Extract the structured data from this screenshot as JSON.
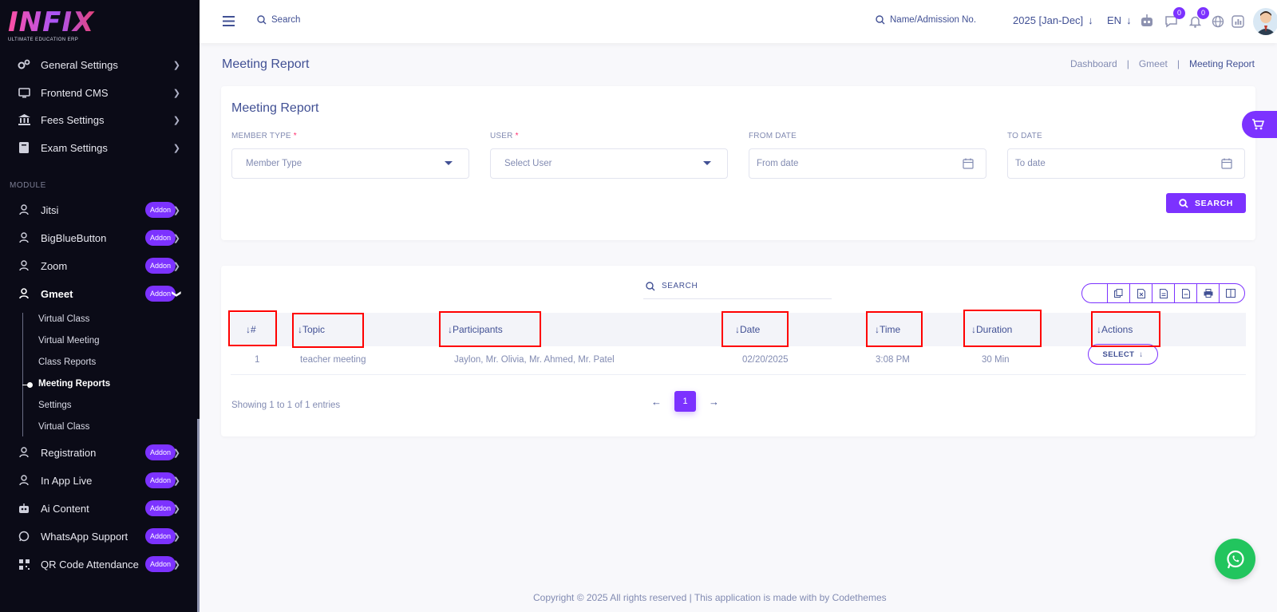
{
  "brand": {
    "name": "INFIX",
    "tagline": "ULTIMATE EDUCATION ERP",
    "accent": "#7c32ff"
  },
  "sidebar": {
    "items": [
      {
        "label": "General Settings",
        "icon": "gears-icon"
      },
      {
        "label": "Frontend CMS",
        "icon": "monitor-icon"
      },
      {
        "label": "Fees Settings",
        "icon": "bank-icon"
      },
      {
        "label": "Exam Settings",
        "icon": "book-icon"
      }
    ],
    "module_heading": "MODULE",
    "modules": [
      {
        "label": "Jitsi",
        "badge": "Addon"
      },
      {
        "label": "BigBlueButton",
        "badge": "Addon"
      },
      {
        "label": "Zoom",
        "badge": "Addon"
      },
      {
        "label": "Gmeet",
        "badge": "Addon"
      }
    ],
    "gmeet_sub": [
      "Virtual Class",
      "Virtual Meeting",
      "Class Reports",
      "Meeting Reports",
      "Settings",
      "Virtual Class"
    ],
    "more_modules": [
      {
        "label": "Registration",
        "badge": "Addon"
      },
      {
        "label": "In App Live",
        "badge": "Addon"
      },
      {
        "label": "Ai Content",
        "badge": "Addon"
      },
      {
        "label": "WhatsApp Support",
        "badge": "Addon"
      },
      {
        "label": "QR Code Attendance",
        "badge": "Addon"
      }
    ]
  },
  "topbar": {
    "search_label": "Search",
    "student_search": "Name/Admission No.",
    "session": "2025 [Jan-Dec]",
    "language": "EN",
    "chat_count": "0",
    "notif_count": "0"
  },
  "page": {
    "title": "Meeting Report",
    "breadcrumb": [
      "Dashboard",
      "Gmeet",
      "Meeting Report"
    ]
  },
  "filter": {
    "title": "Meeting Report",
    "member_type_label": "MEMBER TYPE",
    "member_type_placeholder": "Member Type",
    "user_label": "USER",
    "user_placeholder": "Select User",
    "from_label": "FROM DATE",
    "from_placeholder": "From date",
    "to_label": "TO DATE",
    "to_placeholder": "To date",
    "required_mark": "*",
    "search_button": "SEARCH"
  },
  "table": {
    "search_label": "SEARCH",
    "columns": [
      "#",
      "Topic",
      "Participants",
      "Date",
      "Time",
      "Duration",
      "Actions"
    ],
    "rows": [
      {
        "num": "1",
        "topic": "teacher meeting",
        "participants": "Jaylon, Mr. Olivia, Mr. Ahmed, Mr. Patel",
        "date": "02/20/2025",
        "time": "3:08 PM",
        "duration": "30 Min",
        "action": "SELECT"
      }
    ],
    "showing": "Showing 1 to 1 of 1 entries",
    "page": "1"
  },
  "footer": "Copyright © 2025 All rights reserved | This application is made with by Codethemes"
}
